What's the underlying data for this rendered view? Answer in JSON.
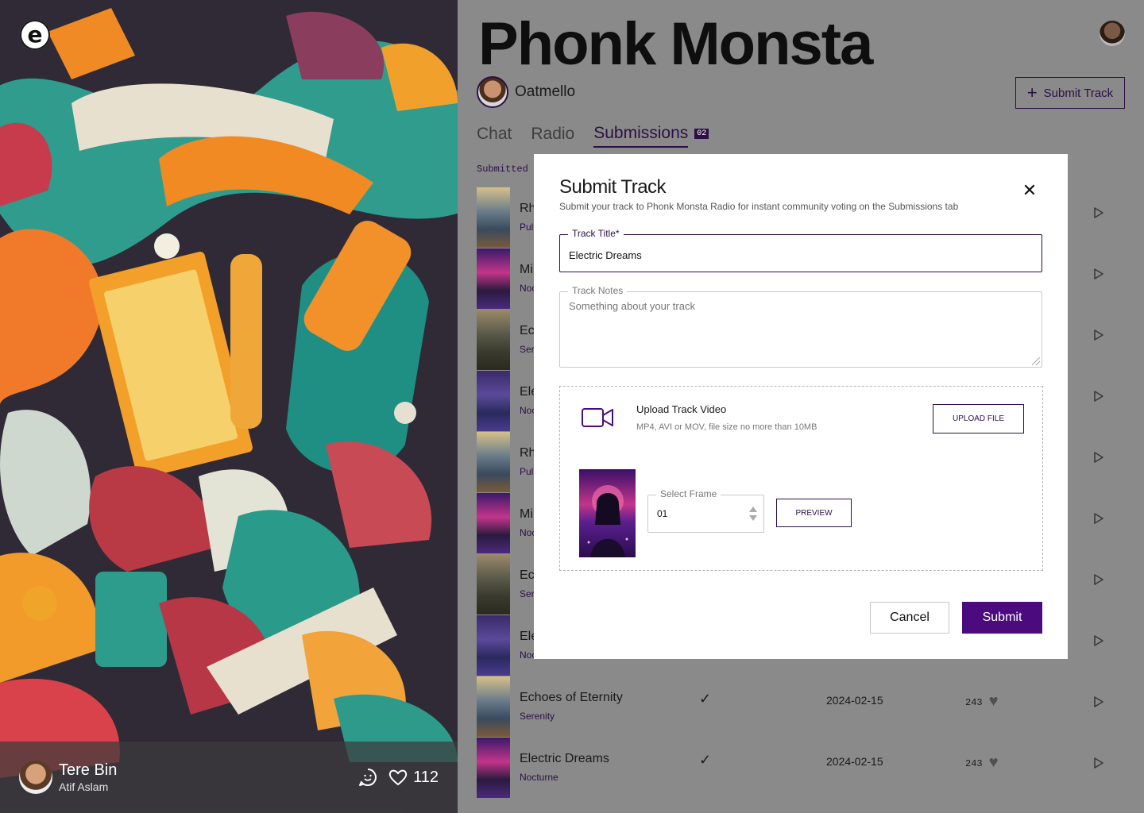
{
  "app": {
    "logo_letter": "e"
  },
  "player": {
    "song": "Tere Bin",
    "artist": "Atif Aslam",
    "likes": "112",
    "comment_icon": "chat-smile-icon",
    "like_icon": "heart-icon"
  },
  "page": {
    "title": "Phonk Monsta",
    "creator": "Oatmello",
    "submit_label": "Submit Track"
  },
  "tabs": [
    {
      "label": "Chat",
      "active": false
    },
    {
      "label": "Radio",
      "active": false
    },
    {
      "label": "Submissions",
      "active": true,
      "badge": "02"
    }
  ],
  "section_label": "Submitted",
  "submissions": [
    {
      "title": "Rh",
      "sub": "Pul"
    },
    {
      "title": "Mi",
      "sub": "Noc"
    },
    {
      "title": "Ec",
      "sub": "Ser"
    },
    {
      "title": "Ele",
      "sub": "Noc"
    },
    {
      "title": "Rh",
      "sub": "Pul"
    },
    {
      "title": "Mi",
      "sub": "Noc"
    },
    {
      "title": "Ec",
      "sub": "Ser"
    },
    {
      "title": "Ele",
      "sub": "Noc"
    },
    {
      "title": "Echoes of Eternity",
      "sub": "Serenity",
      "check": "✓",
      "date": "2024-02-15",
      "votes": "243"
    },
    {
      "title": "Electric Dreams",
      "sub": "Nocturne",
      "check": "✓",
      "date": "2024-02-15",
      "votes": "243"
    }
  ],
  "modal": {
    "title": "Submit Track",
    "description": "Submit your track to Phonk Monsta Radio for instant community voting on the Submissions tab",
    "track_title_label": "Track Title*",
    "track_title_value": "Electric Dreams",
    "track_notes_label": "Track Notes",
    "track_notes_placeholder": "Something about your track",
    "upload_title": "Upload Track Video",
    "upload_hint": "MP4, AVI or MOV, file size no more than 10MB",
    "upload_button": "UPLOAD FILE",
    "frame_label": "Select Frame",
    "frame_value": "01",
    "preview_button": "PREVIEW",
    "cancel_button": "Cancel",
    "submit_button": "Submit"
  },
  "colors": {
    "brand": "#4b0a7d",
    "brand_dark": "#2c0f47",
    "overlay": "#8a8a8a"
  }
}
